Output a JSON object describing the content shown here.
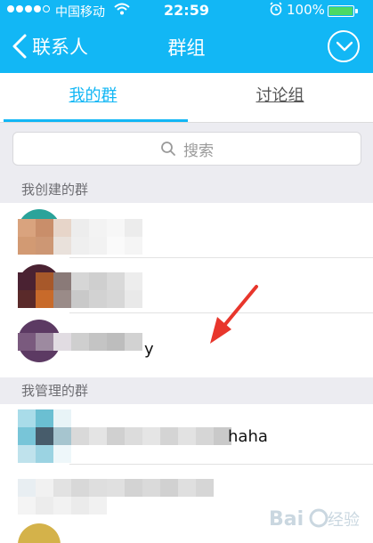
{
  "status_bar": {
    "carrier": "中国移动",
    "time": "22:59",
    "battery": "100%"
  },
  "nav": {
    "back_label": "联系人",
    "title": "群组"
  },
  "tabs": [
    {
      "label": "我的群",
      "active": true
    },
    {
      "label": "讨论组",
      "active": false
    }
  ],
  "search": {
    "placeholder": "搜索"
  },
  "sections": [
    {
      "title": "我创建的群"
    },
    {
      "title": "我管理的群"
    }
  ],
  "rows": [
    {
      "name": ""
    },
    {
      "name": ""
    },
    {
      "name": "y"
    },
    {
      "name": "haha"
    },
    {
      "name": ""
    }
  ],
  "colors": {
    "accent": "#12b7f5",
    "section_bg": "#ececf1",
    "arrow": "#e8362c"
  },
  "icons": [
    "chevron-left-icon",
    "chevron-down-circle-icon",
    "search-icon",
    "wifi-icon",
    "alarm-icon",
    "battery-icon"
  ]
}
